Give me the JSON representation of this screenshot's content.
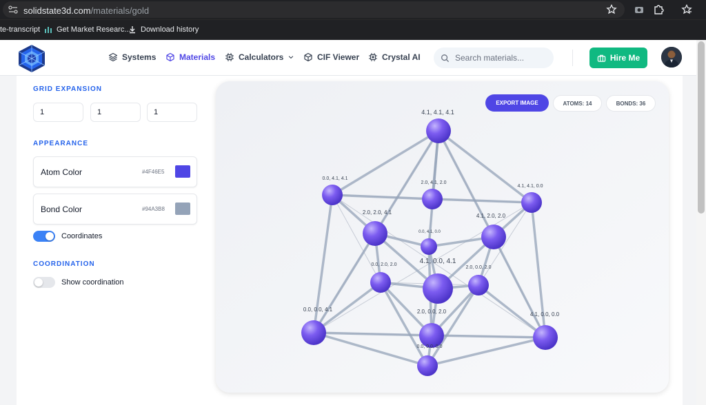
{
  "browser": {
    "url_host": "solidstate3d.com",
    "url_path": "/materials/gold",
    "bookmarks": [
      {
        "label": "te-transcript"
      },
      {
        "label": "Get Market Researc..."
      },
      {
        "label": "Download history"
      }
    ]
  },
  "nav": {
    "items": [
      {
        "label": "Systems",
        "icon": "layers-icon"
      },
      {
        "label": "Materials",
        "icon": "cube-icon"
      },
      {
        "label": "Calculators",
        "icon": "chip-icon"
      },
      {
        "label": "CIF Viewer",
        "icon": "cube-icon"
      },
      {
        "label": "Crystal AI",
        "icon": "chip-icon"
      }
    ],
    "search_placeholder": "Search materials...",
    "hire_label": "Hire Me"
  },
  "panel": {
    "grid_title": "GRID EXPANSION",
    "grid_values": [
      "1",
      "1",
      "1"
    ],
    "appearance_title": "APPEARANCE",
    "atom_color": {
      "label": "Atom Color",
      "hex": "#4F46E5"
    },
    "bond_color": {
      "label": "Bond Color",
      "hex": "#94A3B8"
    },
    "coordinates_label": "Coordinates",
    "coordinates_on": true,
    "coordination_title": "COORDINATION",
    "show_coordination_label": "Show coordination",
    "show_coordination_on": false
  },
  "viewer": {
    "export_label": "EXPORT IMAGE",
    "atoms_label": "ATOMS: 14",
    "bonds_label": "BONDS: 36",
    "atom_labels": [
      "4.1, 4.1, 4.1",
      "0.0, 4.1, 4.1",
      "2.0, 4.1, 2.0",
      "4.1, 4.1, 0.0",
      "2.0, 2.0, 4.1",
      "0.0, 4.1, 0.0",
      "4.1, 2.0, 2.0",
      "4.1, 0.0, 4.1",
      "0.0, 2.0, 2.0",
      "2.0, 0.0, 2.0",
      "0.0, 0.0, 4.1",
      "2.0, 0.0, 2.0",
      "4.1, 0.0, 0.0",
      "0.0, 0.0, 0.0"
    ]
  },
  "colors": {
    "accent": "#4f46e5",
    "hire": "#10b981",
    "section": "#2563eb",
    "toggle_on": "#3b82f6"
  }
}
